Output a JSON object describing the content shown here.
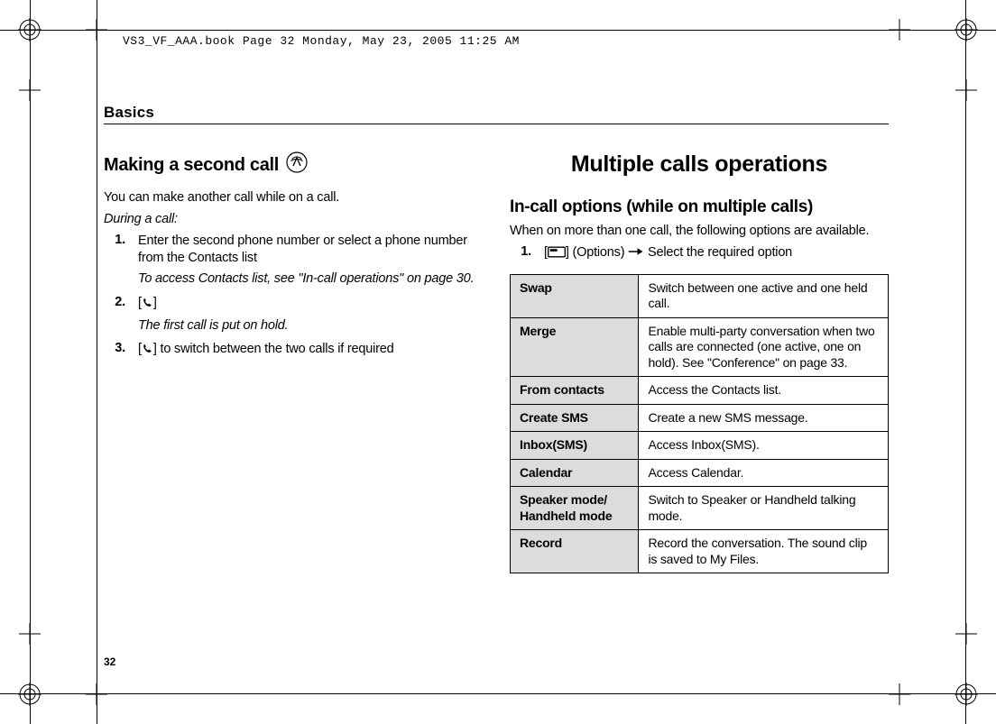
{
  "runhead": "VS3_VF_AAA.book  Page 32  Monday, May 23, 2005  11:25 AM",
  "section_label": "Basics",
  "page_number": "32",
  "left": {
    "heading": "Making a second call",
    "intro": "You can make another call while on a call.",
    "context": "During a call:",
    "steps": [
      {
        "num": "1.",
        "text": "Enter the second phone number or select a phone number from the Contacts list",
        "sub": "To access Contacts list, see \"In-call operations\" on page 30."
      },
      {
        "num": "2.",
        "text_prefix": "[",
        "text_suffix": "]",
        "sub": "The first call is put on hold."
      },
      {
        "num": "3.",
        "text_prefix": "[",
        "text_mid": "] to switch between the two calls if required"
      }
    ]
  },
  "right": {
    "heading": "Multiple calls operations",
    "sub_heading": "In-call options (while on multiple calls)",
    "intro": "When on more than one call, the following options are available.",
    "step": {
      "num": "1.",
      "prefix": "[",
      "options_word": "] (Options) ",
      "suffix": " Select the required option"
    },
    "table": [
      {
        "k": "Swap",
        "v": "Switch between one active and one held call."
      },
      {
        "k": "Merge",
        "v": "Enable multi-party conversation when two calls are connected (one active, one on hold). See \"Conference\" on page 33."
      },
      {
        "k": "From contacts",
        "v": "Access the Contacts list."
      },
      {
        "k": "Create SMS",
        "v": "Create a new SMS message."
      },
      {
        "k": "Inbox(SMS)",
        "v": "Access Inbox(SMS)."
      },
      {
        "k": "Calendar",
        "v": "Access Calendar."
      },
      {
        "k": "Speaker mode/ Handheld mode",
        "v": "Switch to Speaker or Handheld talking mode."
      },
      {
        "k": "Record",
        "v": "Record the conversation. The sound clip is saved to My Files."
      }
    ]
  }
}
